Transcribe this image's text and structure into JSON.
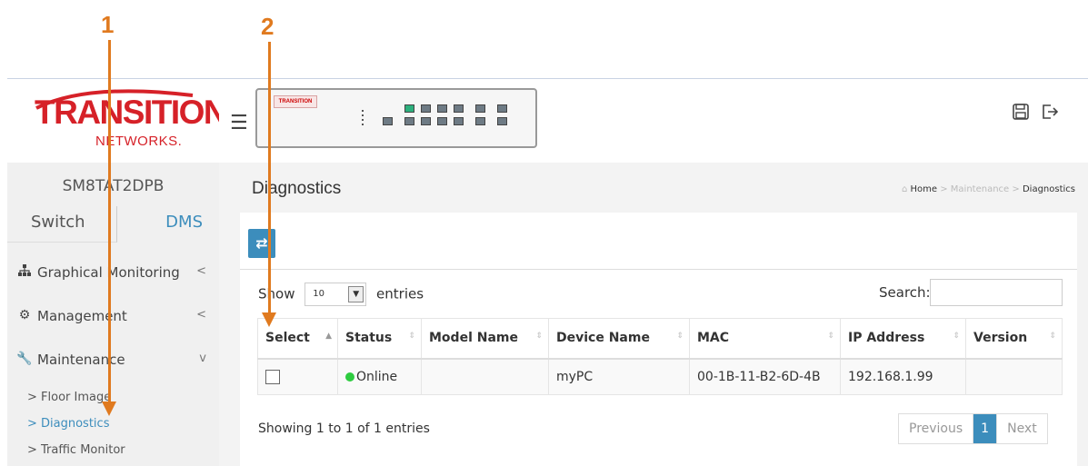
{
  "annotations": {
    "one": "1",
    "two": "2"
  },
  "sidebar": {
    "logo_line1": "TRANSITION",
    "logo_line2": "NETWORKS.",
    "device_name": "SM8TAT2DPB",
    "tabs": [
      {
        "label": "Switch"
      },
      {
        "label": "DMS",
        "active": true
      }
    ],
    "menu": [
      {
        "icon": "sitemap-icon",
        "label": "Graphical Monitoring",
        "arrow": "<"
      },
      {
        "icon": "gear-icon",
        "label": "Management",
        "arrow": "<"
      },
      {
        "icon": "wrench-icon",
        "label": "Maintenance",
        "arrow": "v"
      }
    ],
    "submenu": [
      {
        "label": "> Floor Image"
      },
      {
        "label": "> Diagnostics",
        "active": true
      },
      {
        "label": "> Traffic Monitor"
      }
    ]
  },
  "device_panel": {
    "brand": "TRANSITION"
  },
  "page": {
    "title": "Diagnostics",
    "breadcrumb": {
      "home": "Home",
      "sep": ">",
      "section": "Maintenance",
      "current": "Diagnostics"
    }
  },
  "toolbar": {
    "refresh_icon": "refresh-icon"
  },
  "table_controls": {
    "show": "Show",
    "entries_value": "10",
    "entries": "entries",
    "search_label": "Search:",
    "search_value": ""
  },
  "table": {
    "columns": [
      "Select",
      "Status",
      "Model Name",
      "Device Name",
      "MAC",
      "IP Address",
      "Version"
    ],
    "rows": [
      {
        "select": "",
        "status": "Online",
        "model_name": "",
        "device_name": "myPC",
        "mac": "00-1B-11-B2-6D-4B",
        "ip": "192.168.1.99",
        "version": ""
      }
    ]
  },
  "pagination": {
    "info": "Showing 1 to 1 of 1 entries",
    "previous": "Previous",
    "current": "1",
    "next": "Next"
  },
  "colors": {
    "accent": "#3c8dbc",
    "brand_red": "#d62128",
    "annotation": "#e07a1f",
    "online": "#2ecc40"
  }
}
